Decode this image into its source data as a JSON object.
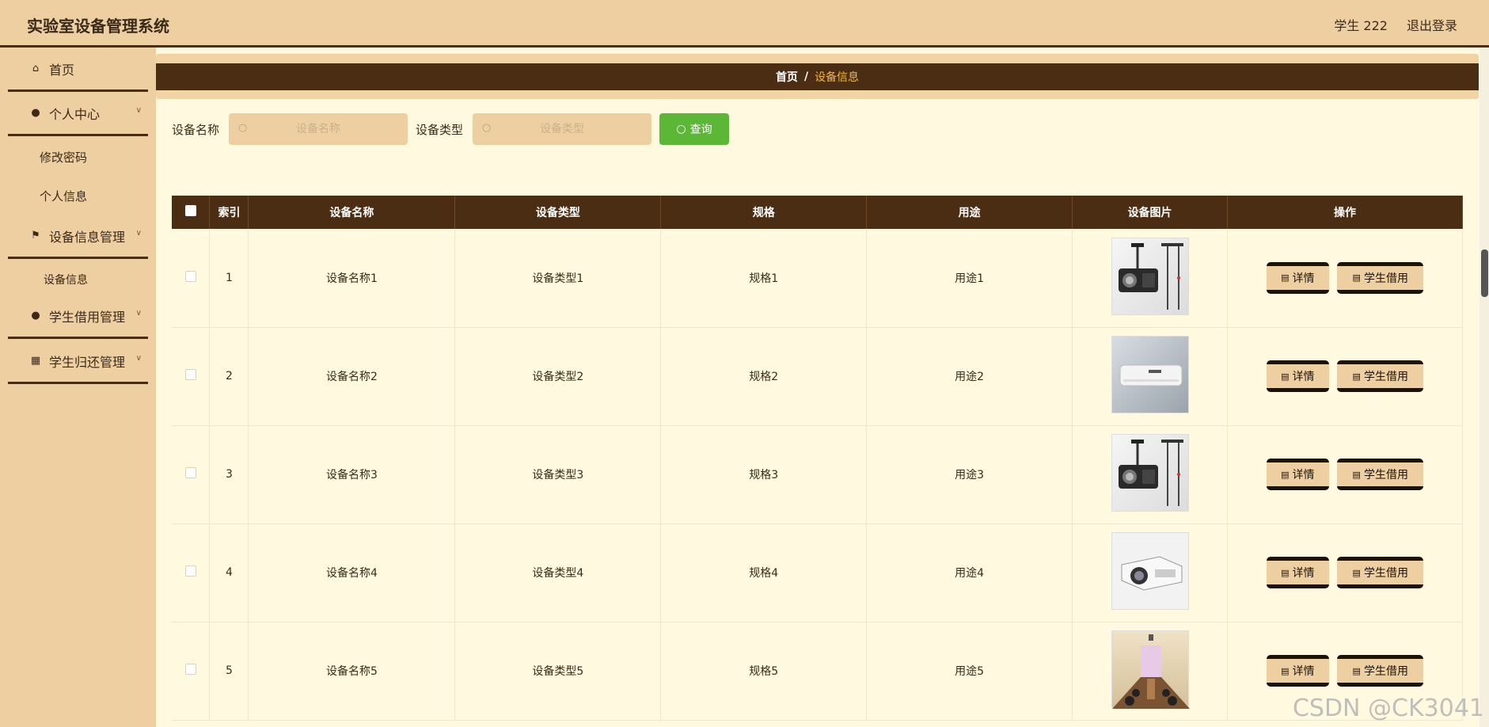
{
  "header": {
    "title": "实验室设备管理系统",
    "user": "学生 222",
    "logout": "退出登录"
  },
  "sidebar": {
    "items": [
      {
        "label": "首页",
        "icon": "home-icon"
      },
      {
        "label": "个人中心",
        "icon": "user-icon"
      },
      {
        "label": "设备信息管理",
        "icon": "flag-icon"
      },
      {
        "label": "学生借用管理",
        "icon": "user-icon"
      },
      {
        "label": "学生归还管理",
        "icon": "grid-icon"
      }
    ],
    "sub_personal": [
      "修改密码",
      "个人信息"
    ],
    "sub_equipment": [
      "设备信息"
    ]
  },
  "breadcrumb": {
    "home": "首页",
    "sep": "/",
    "current": "设备信息"
  },
  "search": {
    "name_label": "设备名称",
    "name_placeholder": "设备名称",
    "type_label": "设备类型",
    "type_placeholder": "设备类型",
    "query_label": "查询"
  },
  "table": {
    "headers": [
      "索引",
      "设备名称",
      "设备类型",
      "规格",
      "用途",
      "设备图片",
      "操作"
    ],
    "rows": [
      {
        "index": "1",
        "name": "设备名称1",
        "type": "设备类型1",
        "spec": "规格1",
        "use": "用途1"
      },
      {
        "index": "2",
        "name": "设备名称2",
        "type": "设备类型2",
        "spec": "规格2",
        "use": "用途2"
      },
      {
        "index": "3",
        "name": "设备名称3",
        "type": "设备类型3",
        "spec": "规格3",
        "use": "用途3"
      },
      {
        "index": "4",
        "name": "设备名称4",
        "type": "设备类型4",
        "spec": "规格4",
        "use": "用途4"
      },
      {
        "index": "5",
        "name": "设备名称5",
        "type": "设备类型5",
        "spec": "规格5",
        "use": "用途5"
      }
    ],
    "detail_label": "详情",
    "borrow_label": "学生借用"
  },
  "watermark": "CSDN @CK3041",
  "colors": {
    "header_bg": "#eecfa1",
    "dark_brown": "#4a2d12",
    "query_green": "#5db736",
    "page_bg": "#fff9e0",
    "breadcrumb_current": "#f3b936"
  }
}
